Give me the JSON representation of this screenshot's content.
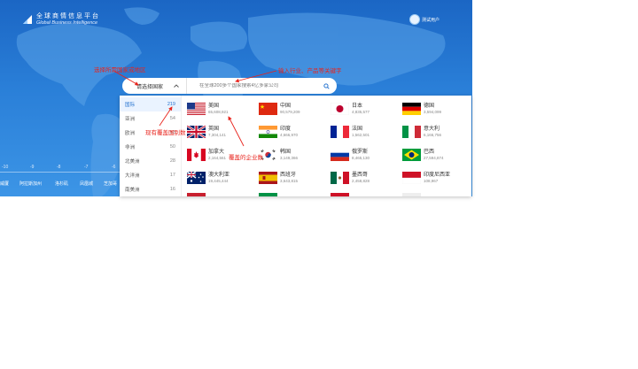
{
  "logo": {
    "cn": "全球商情信息平台",
    "en": "Global Business Intelligence"
  },
  "user": {
    "name": "测试用户"
  },
  "search": {
    "country_label": "请选择国家",
    "placeholder": "在全球200多个国家搜索4亿多家公司"
  },
  "timeline": {
    "ticks": [
      "-10",
      "-9",
      "-8",
      "-7",
      "-6"
    ],
    "cities": [
      "威厦",
      "阿拉斯加州",
      "洛杉矶",
      "凤凰城",
      "芝加哥"
    ]
  },
  "regions": [
    {
      "label": "国际",
      "count": "219",
      "active": true
    },
    {
      "label": "亚洲",
      "count": "54"
    },
    {
      "label": "欧洲",
      "count": "53"
    },
    {
      "label": "非洲",
      "count": "50"
    },
    {
      "label": "北美洲",
      "count": "28"
    },
    {
      "label": "大洋洲",
      "count": "17"
    },
    {
      "label": "南美洲",
      "count": "16"
    }
  ],
  "countries": [
    {
      "name": "美国",
      "num": "65,608,921",
      "flag": "us-flag"
    },
    {
      "name": "中国",
      "num": "90,579,209",
      "flag": "cn-flag"
    },
    {
      "name": "日本",
      "num": "4,835,577",
      "flag": "jp-flag"
    },
    {
      "name": "德国",
      "num": "3,594,099",
      "flag": "de-flag"
    },
    {
      "name": "英国",
      "num": "7,304,141",
      "flag": "uk-flag"
    },
    {
      "name": "印度",
      "num": "4,666,970",
      "flag": "in-flag"
    },
    {
      "name": "法国",
      "num": "1,562,501",
      "flag": "fr-flag"
    },
    {
      "name": "意大利",
      "num": "6,166,756",
      "flag": "it-flag"
    },
    {
      "name": "加拿大",
      "num": "2,164,561",
      "flag": "ca-flag"
    },
    {
      "name": "韩国",
      "num": "3,149,366",
      "flag": "kr-flag"
    },
    {
      "name": "俄罗斯",
      "num": "8,465,130",
      "flag": "ru-flag"
    },
    {
      "name": "巴西",
      "num": "27,594,874",
      "flag": "br-flag"
    },
    {
      "name": "澳大利亚",
      "num": "19,445,444",
      "flag": "au-flag"
    },
    {
      "name": "西班牙",
      "num": "3,643,815",
      "flag": "es-flag"
    },
    {
      "name": "墨西哥",
      "num": "2,458,828",
      "flag": "mx-flag"
    },
    {
      "name": "印度尼西亚",
      "num": "108,967",
      "flag": "id-flag"
    }
  ],
  "annotations": {
    "a1": "选择所需国家或地区",
    "a2": "输入行业、产品等关键字",
    "a3": "现有覆盖国别数",
    "a4": "覆盖的企业数"
  },
  "colors": {
    "accent": "#2472cf",
    "annotation": "#e8231c"
  }
}
